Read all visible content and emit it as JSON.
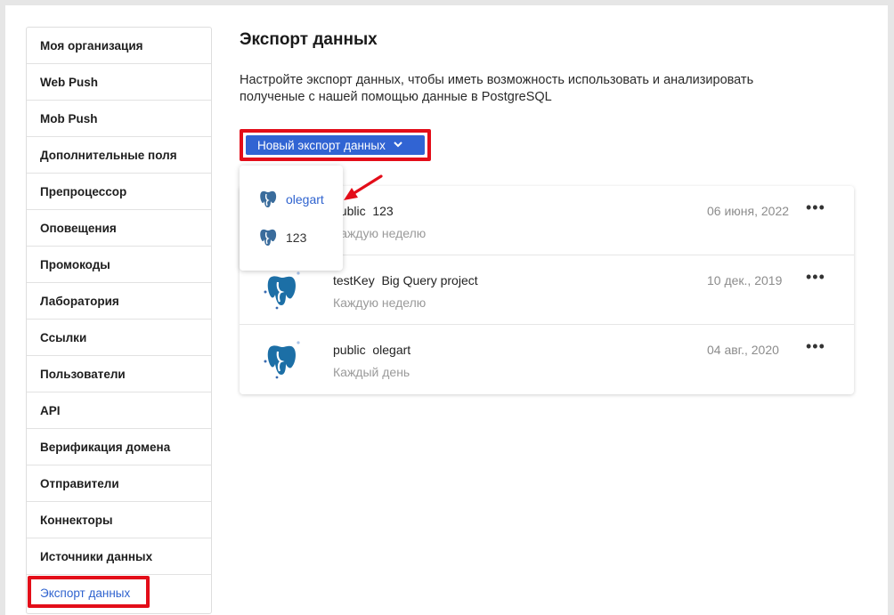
{
  "sidebar": {
    "items": [
      {
        "label": "Моя организация",
        "name": "sidebar-item-my-organization"
      },
      {
        "label": "Web Push",
        "name": "sidebar-item-web-push"
      },
      {
        "label": "Mob Push",
        "name": "sidebar-item-mob-push"
      },
      {
        "label": "Дополнительные поля",
        "name": "sidebar-item-additional-fields"
      },
      {
        "label": "Препроцессор",
        "name": "sidebar-item-preprocessor"
      },
      {
        "label": "Оповещения",
        "name": "sidebar-item-notifications"
      },
      {
        "label": "Промокоды",
        "name": "sidebar-item-promocodes"
      },
      {
        "label": "Лаборатория",
        "name": "sidebar-item-laboratory"
      },
      {
        "label": "Ссылки",
        "name": "sidebar-item-links"
      },
      {
        "label": "Пользователи",
        "name": "sidebar-item-users"
      },
      {
        "label": "API",
        "name": "sidebar-item-api"
      },
      {
        "label": "Верификация домена",
        "name": "sidebar-item-domain-verification"
      },
      {
        "label": "Отправители",
        "name": "sidebar-item-senders"
      },
      {
        "label": "Коннекторы",
        "name": "sidebar-item-connectors"
      },
      {
        "label": "Источники данных",
        "name": "sidebar-item-data-sources"
      },
      {
        "label": "Экспорт данных",
        "name": "sidebar-item-data-export",
        "active": true
      }
    ]
  },
  "main": {
    "title": "Экспорт данных",
    "description": "Настройте экспорт данных, чтобы иметь возможность использовать и анализировать полученые с нашей помощью данные в PostgreSQL",
    "new_export_button": "Новый экспорт данных",
    "dropdown": {
      "items": [
        {
          "label": "olegart",
          "highlighted": true
        },
        {
          "label": "123",
          "highlighted": false
        }
      ]
    },
    "exports": [
      {
        "name": "public  123",
        "frequency": "Каждую неделю",
        "date": "06 июня, 2022"
      },
      {
        "name": "testKey  Big Query project",
        "frequency": "Каждую неделю",
        "date": "10 дек., 2019"
      },
      {
        "name": "public  olegart",
        "frequency": "Каждый день",
        "date": "04 авг., 2020"
      }
    ],
    "more_label": "•••"
  },
  "icons": {
    "database": "postgresql-elephant-icon",
    "more": "more-horizontal-icon",
    "chevron": "chevron-down-icon",
    "annotation_arrow": "red-arrow-annotation"
  },
  "colors": {
    "accent": "#3164d3",
    "highlight": "#e30d19",
    "postgres_blue": "#1c6fa6"
  }
}
